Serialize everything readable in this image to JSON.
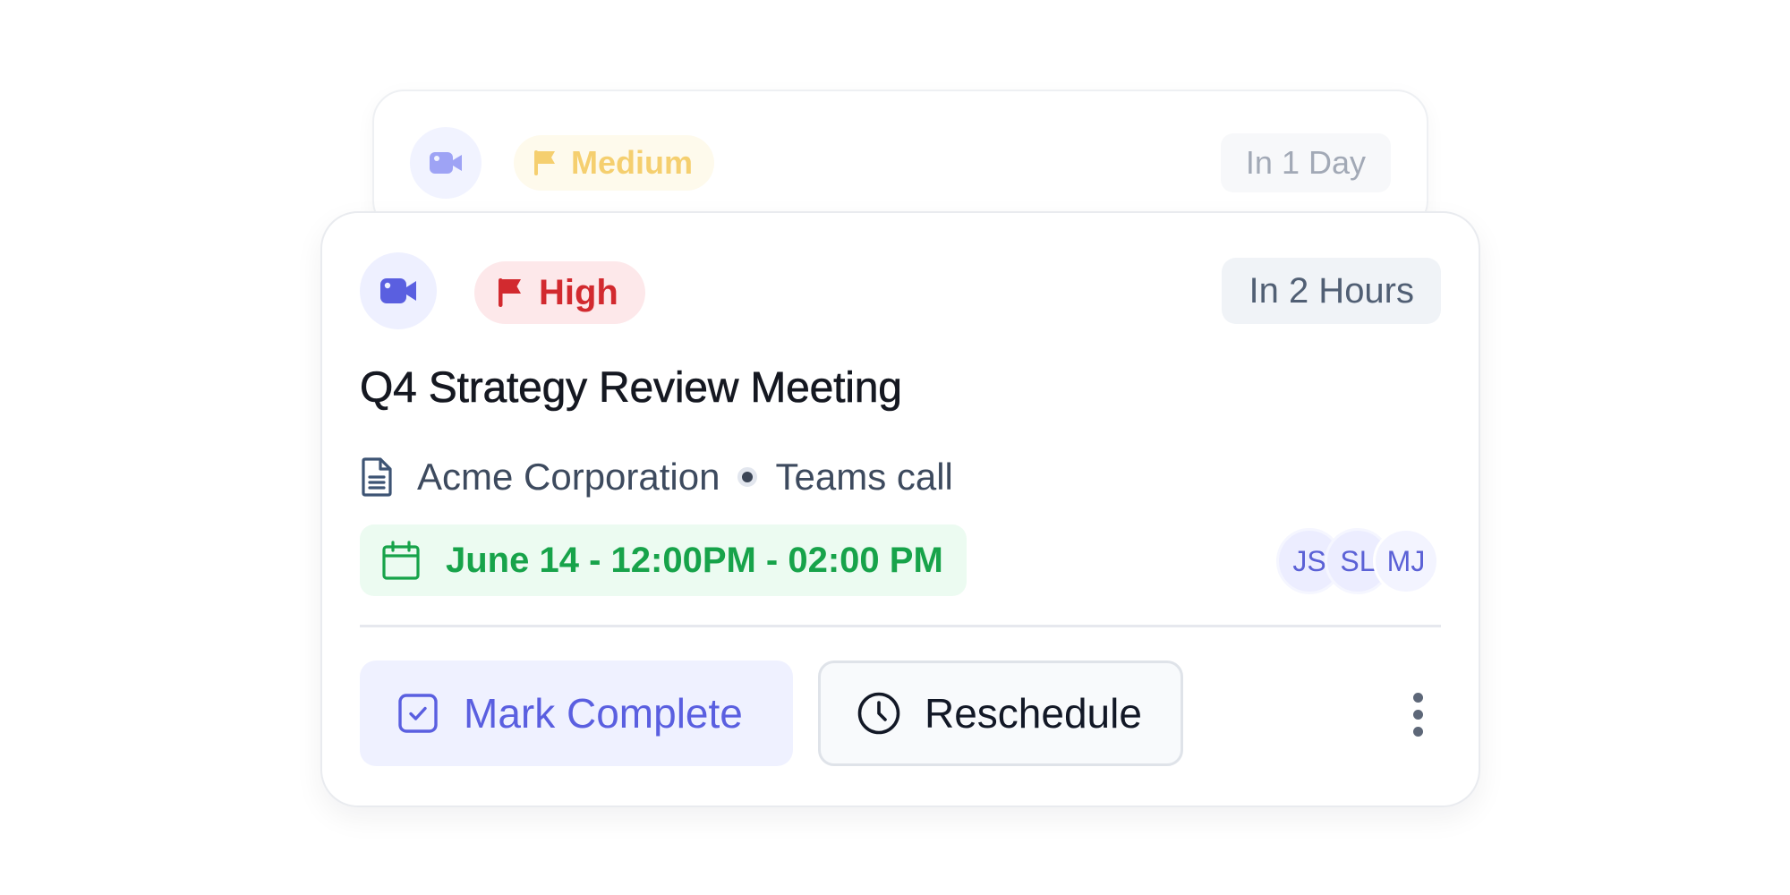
{
  "back_card": {
    "priority": "Medium",
    "due": "In 1 Day",
    "icon": "video-camera-icon",
    "colors": {
      "priority_bg": "#fefaec",
      "priority_fg": "#f5cf6f",
      "icon": "#9ea3f5"
    }
  },
  "card": {
    "icon": "video-camera-icon",
    "priority": "High",
    "due": "In 2 Hours",
    "title": "Q4 Strategy Review Meeting",
    "company": "Acme Corporation",
    "call_type": "Teams call",
    "schedule": "June 14 - 12:00PM - 02:00 PM",
    "attendees": [
      "JS",
      "SL",
      "MJ"
    ],
    "actions": {
      "complete_label": "Mark Complete",
      "reschedule_label": "Reschedule"
    },
    "colors": {
      "accent": "#5a5fe0",
      "priority_bg": "#fde8ea",
      "priority_fg": "#d22a2f",
      "date_bg": "#ecfbf1",
      "date_fg": "#17a34a"
    }
  }
}
